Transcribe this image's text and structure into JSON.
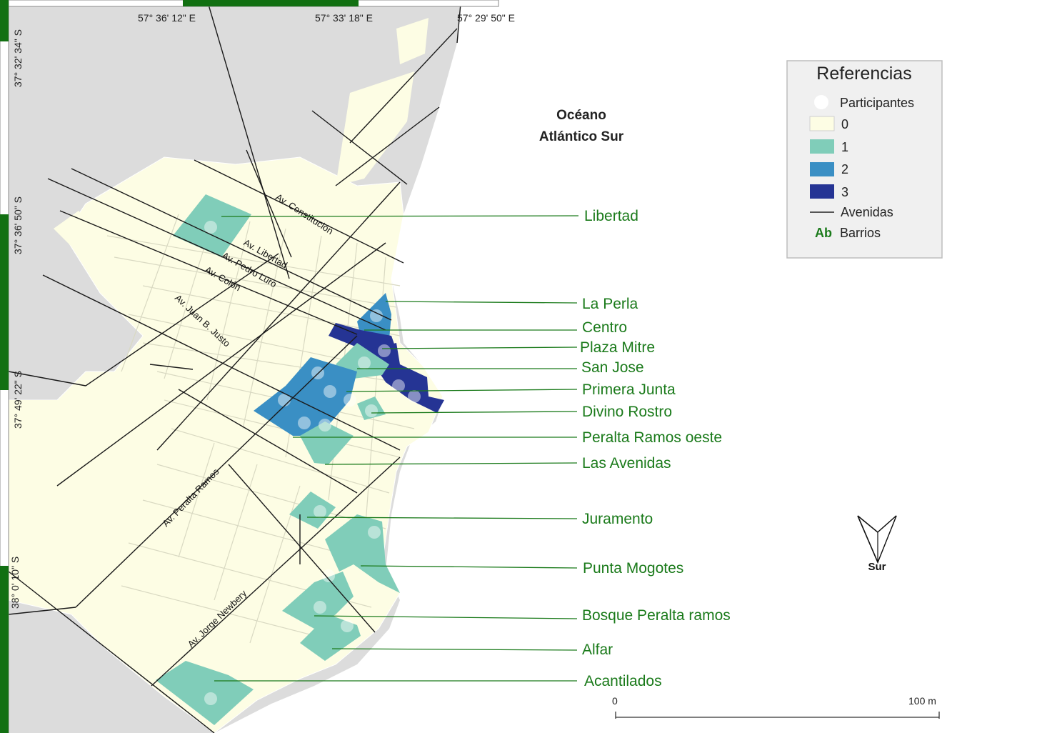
{
  "map": {
    "ocean_label": [
      "Océano",
      "Atlántico Sur"
    ],
    "coords_top": [
      "57° 36' 12\" E",
      "57° 33' 18\" E",
      "57° 29' 50\" E"
    ],
    "coords_left": [
      "37° 32' 34\" S",
      "37° 36' 50\" S",
      "37° 49' 22\" S",
      "38° 0' 10\" S"
    ],
    "avenues": [
      "Av. Constitución",
      "Av. Libertad",
      "Av. Pedro Luro",
      "Av. Colón",
      "Av. Juan B. Justo",
      "Av. Peralta Ramos",
      "Av. Jorge Newbery"
    ],
    "barrios": [
      {
        "name": "Libertad",
        "participants": 1
      },
      {
        "name": "La Perla",
        "participants": 2
      },
      {
        "name": "Centro",
        "participants": 3
      },
      {
        "name": "Plaza Mitre",
        "participants": 3
      },
      {
        "name": "San Jose",
        "participants": 1
      },
      {
        "name": "Primera Junta",
        "participants": 2
      },
      {
        "name": "Divino Rostro",
        "participants": 1
      },
      {
        "name": "Peralta Ramos oeste",
        "participants": 1
      },
      {
        "name": "Las Avenidas",
        "participants": 1
      },
      {
        "name": "Juramento",
        "participants": 1
      },
      {
        "name": "Punta Mogotes",
        "participants": 1
      },
      {
        "name": "Bosque Peralta ramos",
        "participants": 1
      },
      {
        "name": "Alfar",
        "participants": 1
      },
      {
        "name": "Acantilados",
        "participants": 1
      }
    ],
    "north_arrow_label": "Sur",
    "scale": {
      "start": "0",
      "end": "100 m"
    }
  },
  "legend": {
    "title": "Referencias",
    "participants_label": "Participantes",
    "classes": [
      {
        "label": "0",
        "color": "#fdfde4"
      },
      {
        "label": "1",
        "color": "#80cdb9"
      },
      {
        "label": "2",
        "color": "#3a8fc4"
      },
      {
        "label": "3",
        "color": "#253494"
      }
    ],
    "avenidas_label": "Avenidas",
    "barrios_symbol": "Ab",
    "barrios_label": "Barrios"
  },
  "colors": {
    "land_other": "#dcdcdc",
    "city_base": "#fdfde4",
    "label_green": "#1a7a1a",
    "frame_green": "#127012"
  }
}
